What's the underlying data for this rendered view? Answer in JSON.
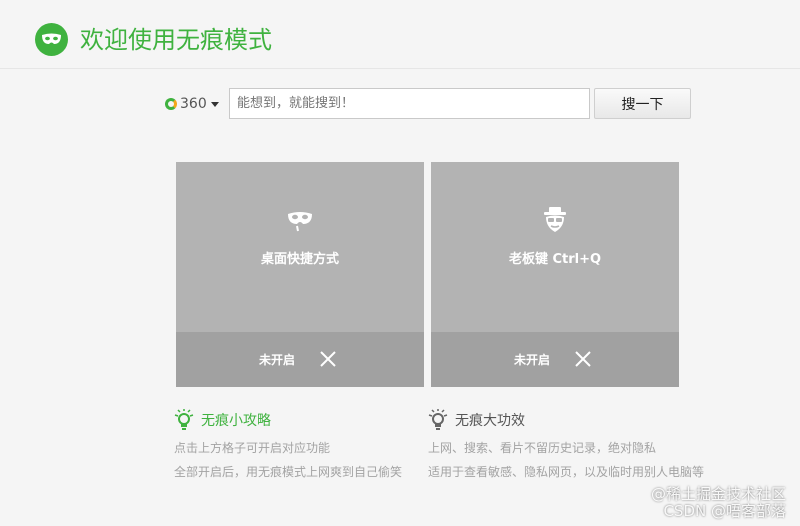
{
  "header": {
    "title": "欢迎使用无痕模式",
    "logo_icon": "mask-icon",
    "accent_color": "#3fb23f"
  },
  "search": {
    "engine_label": "360",
    "placeholder": "能想到，就能搜到！",
    "button_label": "搜一下"
  },
  "cards": [
    {
      "icon": "mask-icon",
      "label": "桌面快捷方式",
      "status": "未开启",
      "action_icon": "close-icon"
    },
    {
      "icon": "boss-icon",
      "label": "老板键 Ctrl+Q",
      "status": "未开启",
      "action_icon": "close-icon"
    }
  ],
  "tips": [
    {
      "title": "无痕小攻略",
      "icon": "bulb-icon",
      "lines": [
        "点击上方格子可开启对应功能",
        "全部开启后，用无痕模式上网爽到自己偷笑"
      ]
    },
    {
      "title": "无痕大功效",
      "icon": "bulb-icon",
      "lines": [
        "上网、搜索、看片不留历史记录，绝对隐私",
        "适用于查看敏感、隐私网页，以及临时用别人电脑等"
      ]
    }
  ],
  "watermark": {
    "line1": "@稀土掘金技术社区",
    "line2": "CSDN @唔客部落"
  }
}
